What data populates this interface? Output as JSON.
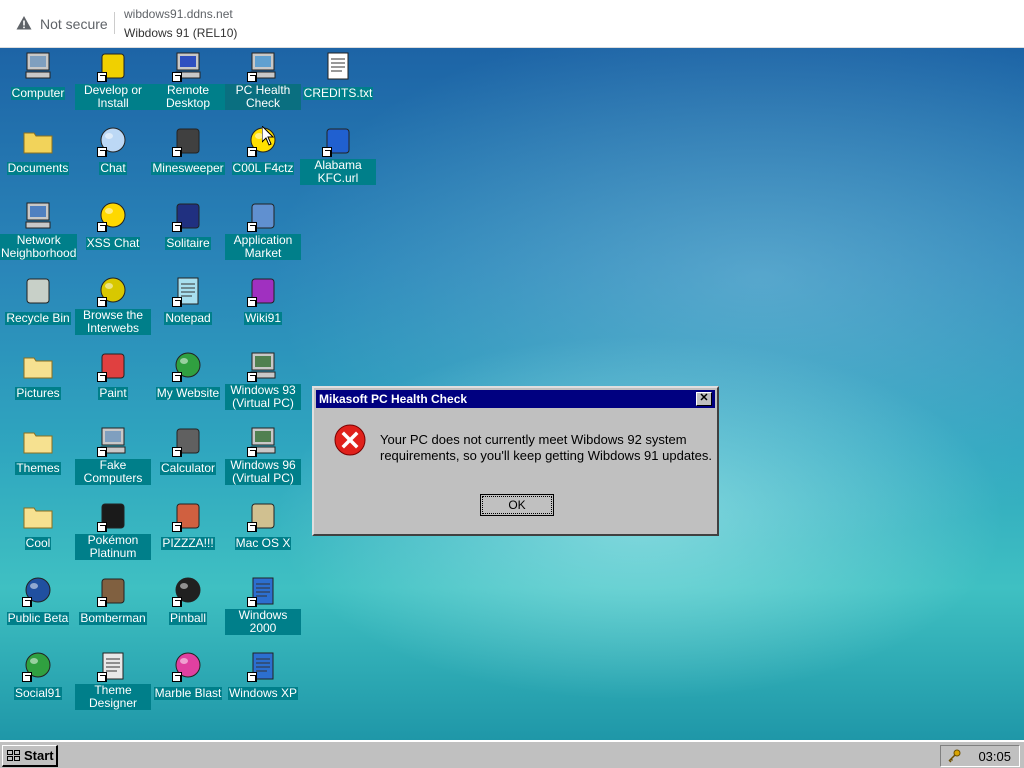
{
  "browser": {
    "security_text": "Not secure",
    "url": "wibdows91.ddns.net",
    "page_title": "Wibdows 91 (REL10)"
  },
  "desktop": {
    "icons": [
      {
        "label": "Computer",
        "icon": "computer-icon"
      },
      {
        "label": "Develop or Install",
        "icon": "develop-install-icon"
      },
      {
        "label": "Remote Desktop",
        "icon": "remote-desktop-icon"
      },
      {
        "label": "PC Health Check",
        "icon": "pc-health-check-icon"
      },
      {
        "label": "CREDITS.txt",
        "icon": "text-file-icon"
      },
      {
        "label": "Documents",
        "icon": "documents-folder-icon"
      },
      {
        "label": "Chat",
        "icon": "chat-bubble-icon"
      },
      {
        "label": "Minesweeper",
        "icon": "mine-icon"
      },
      {
        "label": "C00L F4ctz",
        "icon": "lightbulb-icon"
      },
      {
        "label": "Alabama KFC.url",
        "icon": "internet-shortcut-icon"
      },
      {
        "label": "Network Neighborhood",
        "icon": "network-icon"
      },
      {
        "label": "XSS Chat",
        "icon": "warning-chat-icon"
      },
      {
        "label": "Solitaire",
        "icon": "cards-icon"
      },
      {
        "label": "Application Market",
        "icon": "shopping-bag-icon"
      },
      {
        "label": "Recycle Bin",
        "icon": "recycle-bin-icon"
      },
      {
        "label": "Browse the Interwebs",
        "icon": "browser-ring-icon"
      },
      {
        "label": "Notepad",
        "icon": "notepad-icon"
      },
      {
        "label": "Wiki91",
        "icon": "book-icon"
      },
      {
        "label": "Pictures",
        "icon": "folder-icon"
      },
      {
        "label": "Paint",
        "icon": "paint-icon"
      },
      {
        "label": "My Website",
        "icon": "globe-icon"
      },
      {
        "label": "Windows 93 (Virtual PC)",
        "icon": "virtual-pc-icon"
      },
      {
        "label": "Themes",
        "icon": "folder-icon"
      },
      {
        "label": "Fake Computers",
        "icon": "computer-icon"
      },
      {
        "label": "Calculator",
        "icon": "calculator-icon"
      },
      {
        "label": "Windows 96 (Virtual PC)",
        "icon": "virtual-pc-icon"
      },
      {
        "label": "Cool",
        "icon": "folder-icon"
      },
      {
        "label": "Pokémon Platinum",
        "icon": "pokemon-icon"
      },
      {
        "label": "PIZZZA!!!",
        "icon": "pizza-icon"
      },
      {
        "label": "Mac OS X",
        "icon": "mac-os-icon"
      },
      {
        "label": "Public Beta",
        "icon": "windows-globe-icon"
      },
      {
        "label": "Bomberman",
        "icon": "bomb-icon"
      },
      {
        "label": "Pinball",
        "icon": "pinball-icon"
      },
      {
        "label": "Windows 2000",
        "icon": "windows-logo-icon"
      },
      {
        "label": "Social91",
        "icon": "globe-icon"
      },
      {
        "label": "Theme Designer",
        "icon": "window-icon"
      },
      {
        "label": "Marble Blast",
        "icon": "marble-icon"
      },
      {
        "label": "Windows XP",
        "icon": "windows-logo-icon"
      }
    ]
  },
  "dialog": {
    "title": "Mikasoft PC Health Check",
    "close_label": "✕",
    "message": "Your PC does not currently meet Wibdows 92 system requirements, so you'll keep getting Wibdows 91 updates.",
    "ok_label": "OK"
  },
  "taskbar": {
    "start_label": "Start",
    "clock": "03:05"
  },
  "colors": {
    "titlebar": "#000080",
    "label_bg": "#007f8a",
    "error_red": "#e0211b",
    "taskbar": "#c0c0c0"
  }
}
